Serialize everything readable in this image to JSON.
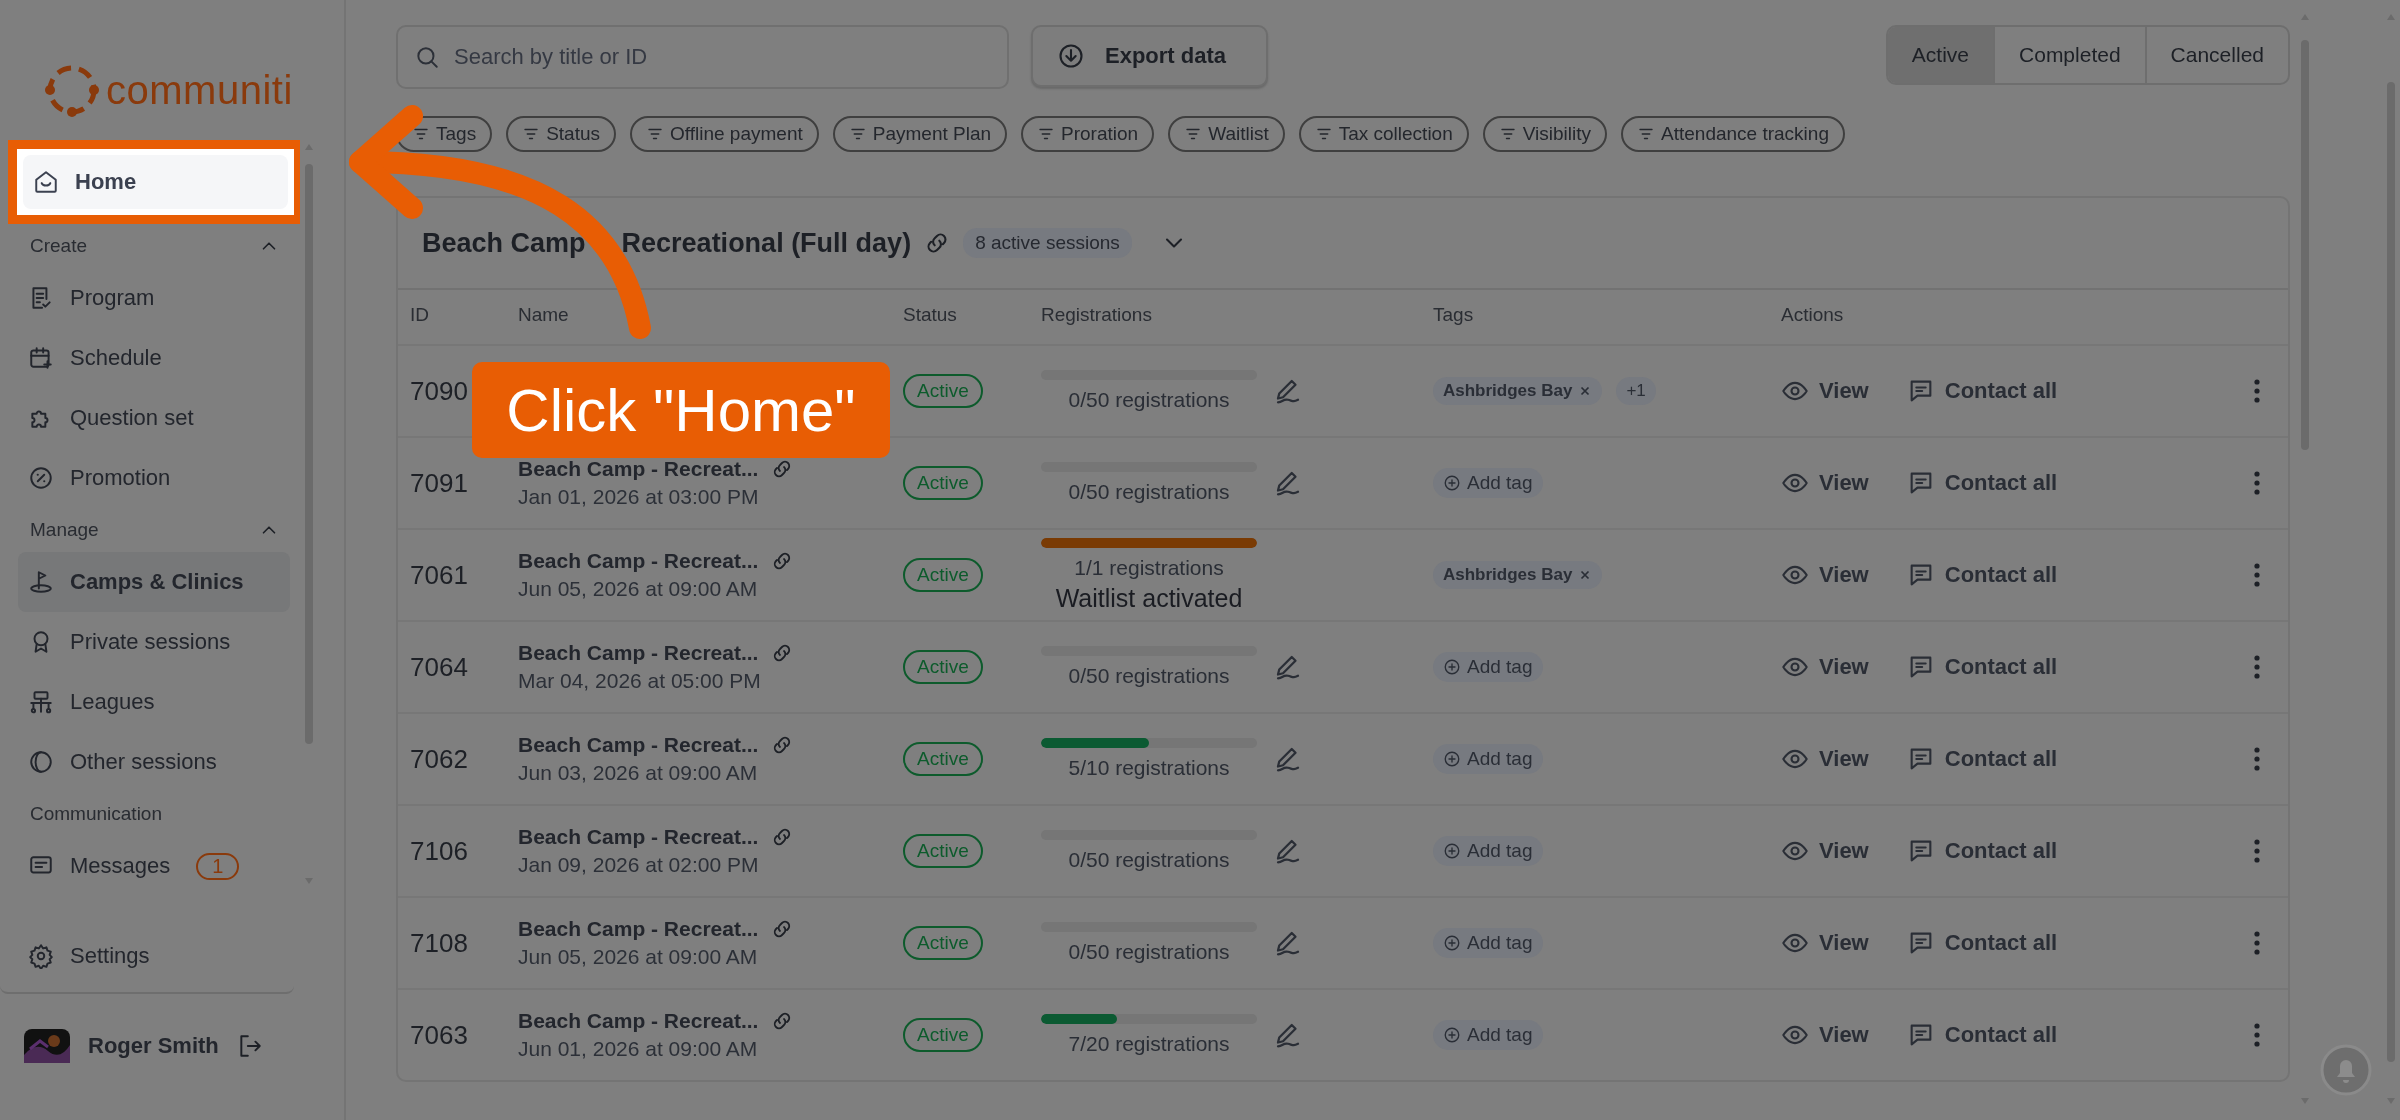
{
  "sidebar": {
    "logo": "communiti",
    "home": {
      "label": "Home",
      "selected": true
    },
    "sections": [
      {
        "title": "Create",
        "expanded": true,
        "items": [
          {
            "label": "Program",
            "selected": false
          },
          {
            "label": "Schedule",
            "selected": false
          },
          {
            "label": "Question set",
            "selected": false
          },
          {
            "label": "Promotion",
            "selected": false
          }
        ]
      },
      {
        "title": "Manage",
        "expanded": true,
        "items": [
          {
            "label": "Camps & Clinics",
            "selected": true
          },
          {
            "label": "Private sessions",
            "selected": false
          },
          {
            "label": "Leagues",
            "selected": false
          },
          {
            "label": "Other sessions",
            "selected": false
          }
        ]
      },
      {
        "title": "Communication",
        "items": [
          {
            "label": "Messages",
            "selected": false,
            "badge": "1"
          }
        ]
      }
    ],
    "settings": "Settings",
    "user": {
      "name": "Roger Smith"
    }
  },
  "toolbar": {
    "search": {
      "placeholder": "Search by title or ID"
    },
    "export": "Export data",
    "status_tabs": [
      {
        "label": "Active",
        "selected": true
      },
      {
        "label": "Completed",
        "selected": false
      },
      {
        "label": "Cancelled",
        "selected": false
      }
    ],
    "filters": [
      "Tags",
      "Status",
      "Offline payment",
      "Payment Plan",
      "Proration",
      "Waitlist",
      "Tax collection",
      "Visibility",
      "Attendance tracking"
    ]
  },
  "group": {
    "title": [
      "Beach Camp",
      "Recreational (Full day)"
    ],
    "sessions": "8 active sessions",
    "expanded": false,
    "columns": [
      "ID",
      "Name",
      "Status",
      "Registrations",
      "Tags",
      "Actions"
    ],
    "rows": [
      {
        "id": "7090",
        "status": "Active",
        "registrations": "0/50 registrations",
        "level": 0,
        "editable": true,
        "tags": [
          {
            "label": "Ashbridges Bay"
          }
        ],
        "more": "+1",
        "actions": [
          "View",
          "Contact all"
        ]
      },
      {
        "id": "7091",
        "name": "Beach Camp - Recreat...",
        "date": "Jan 01, 2026 at 03:00 PM",
        "status": "Active",
        "registrations": "0/50 registrations",
        "level": 0,
        "editable": true,
        "add_tag": "Add tag",
        "actions": [
          "View",
          "Contact all"
        ]
      },
      {
        "id": "7061",
        "name": "Beach Camp - Recreat...",
        "date": "Jun 05, 2026 at 09:00 AM",
        "status": "Active",
        "registrations": "1/1 registrations",
        "note": "Waitlist activated",
        "level": 1,
        "color": "#7a3b04",
        "editable": false,
        "tags": [
          {
            "label": "Ashbridges Bay"
          }
        ],
        "actions": [
          "View",
          "Contact all"
        ]
      },
      {
        "id": "7064",
        "name": "Beach Camp - Recreat...",
        "date": "Mar 04, 2026 at 05:00 PM",
        "status": "Active",
        "registrations": "0/50 registrations",
        "level": 0,
        "editable": true,
        "add_tag": "Add tag",
        "actions": [
          "View",
          "Contact all"
        ]
      },
      {
        "id": "7062",
        "name": "Beach Camp - Recreat...",
        "date": "Jun 03, 2026 at 09:00 AM",
        "status": "Active",
        "registrations": "5/10 registrations",
        "level": 0.5,
        "color": "#0b5a32",
        "editable": true,
        "add_tag": "Add tag",
        "actions": [
          "View",
          "Contact all"
        ]
      },
      {
        "id": "7106",
        "name": "Beach Camp - Recreat...",
        "date": "Jan 09, 2026 at 02:00 PM",
        "status": "Active",
        "registrations": "0/50 registrations",
        "level": 0,
        "editable": true,
        "add_tag": "Add tag",
        "actions": [
          "View",
          "Contact all"
        ]
      },
      {
        "id": "7108",
        "name": "Beach Camp - Recreat...",
        "date": "Jun 05, 2026 at 09:00 AM",
        "status": "Active",
        "registrations": "0/50 registrations",
        "level": 0,
        "editable": true,
        "add_tag": "Add tag",
        "actions": [
          "View",
          "Contact all"
        ]
      },
      {
        "id": "7063",
        "name": "Beach Camp - Recreat...",
        "date": "Jun 01, 2026 at 09:00 AM",
        "status": "Active",
        "registrations": "7/20 registrations",
        "level": 0.35,
        "color": "#0b5a32",
        "editable": true,
        "add_tag": "Add tag",
        "actions": [
          "View",
          "Contact all"
        ]
      }
    ]
  },
  "tutorial": {
    "callout": "Click \"Home\""
  }
}
